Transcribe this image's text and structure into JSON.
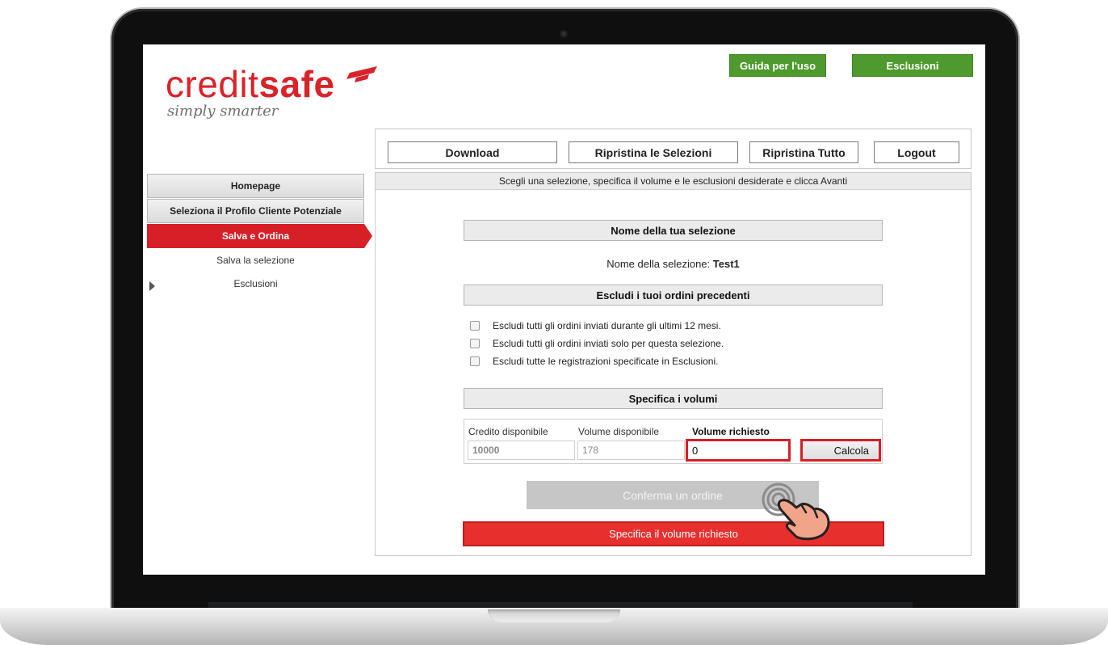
{
  "brand": {
    "logo_word_regular": "credit",
    "logo_word_bold": "safe",
    "tagline": "simply smarter",
    "color_red": "#d9232a",
    "color_green": "#4e9a2e"
  },
  "top_buttons": {
    "guide": "Guida per l'uso",
    "exclusions": "Esclusioni"
  },
  "toolbar": {
    "download": "Download",
    "reset_selections": "Ripristina le Selezioni",
    "reset_all": "Ripristina Tutto",
    "logout": "Logout"
  },
  "sidebar": {
    "homepage": "Homepage",
    "select_profile": "Seleziona il Profilo Cliente Potenziale",
    "save_order": "Salva e Ordina",
    "save_selection": "Salva la selezione",
    "exclusions": "Esclusioni"
  },
  "main": {
    "instruction": "Scegli una selezione, specifica il volume e le esclusioni desiderate e clicca Avanti",
    "selection_name_header": "Nome della tua selezione",
    "selection_name_label": "Nome della selezione:",
    "selection_name_value": "Test1",
    "exclude_header": "Escludi i tuoi ordini precedenti",
    "exclude_options": [
      "Escludi tutti gli ordini inviati durante gli ultimi 12 mesi.",
      "Escludi tutti gli ordini inviati solo per questa selezione.",
      "Escludi tutte le registrazioni specificate in Esclusioni."
    ],
    "volumes_header": "Specifica i volumi",
    "credit_label": "Credito disponibile",
    "credit_value": "10000",
    "volume_available_label": "Volume disponibile",
    "volume_available_value": "178",
    "volume_requested_label": "Volume richiesto",
    "volume_requested_value": "0",
    "calculate_label": "Calcola",
    "confirm_label": "Conferma un ordine",
    "specify_volume_msg": "Specifica il volume richiesto"
  }
}
